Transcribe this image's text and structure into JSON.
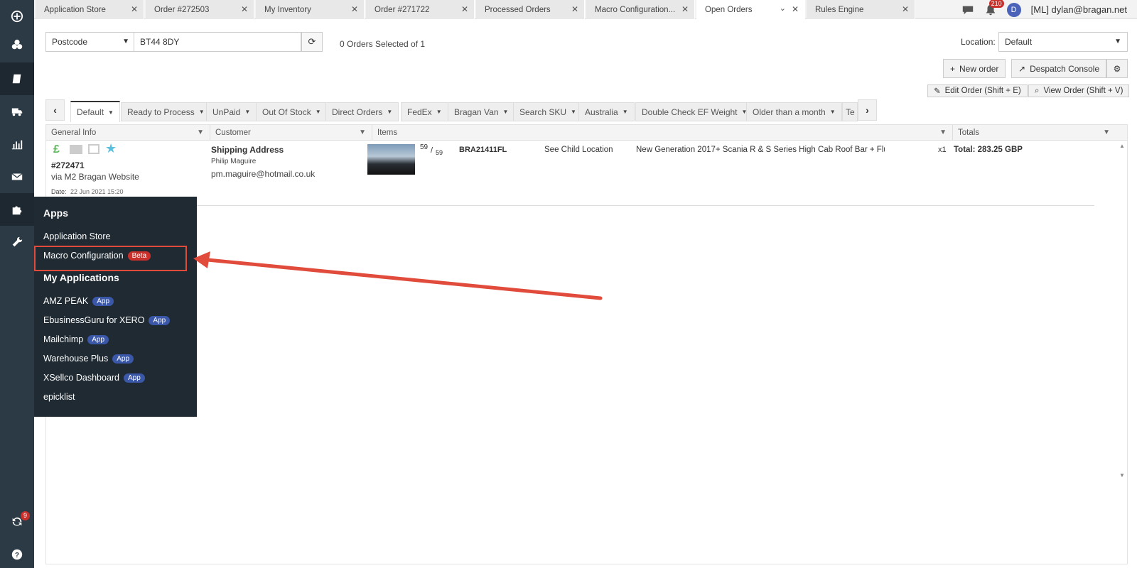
{
  "tabs": [
    {
      "label": "Application Store"
    },
    {
      "label": "Order #272503"
    },
    {
      "label": "My Inventory"
    },
    {
      "label": "Order #271722"
    },
    {
      "label": "Processed Orders"
    },
    {
      "label": "Macro Configuration..."
    },
    {
      "label": "Open Orders"
    },
    {
      "label": "Rules Engine"
    }
  ],
  "topbar": {
    "notification_count": "210",
    "avatar_letter": "D",
    "user": "[ML] dylan@bragan.net"
  },
  "rail": {
    "sync_badge": "9"
  },
  "search": {
    "field": "Postcode",
    "value": "BT44 8DY",
    "selection_text": "0 Orders Selected of 1"
  },
  "location": {
    "label": "Location:",
    "value": "Default"
  },
  "actions": {
    "new_order": "New order",
    "despatch_console": "Despatch Console",
    "edit_order": "Edit Order (Shift + E)",
    "view_order": "View Order (Shift + V)"
  },
  "view_tabs": [
    {
      "label": "Default"
    },
    {
      "label": "Ready to Process"
    },
    {
      "label": "UnPaid"
    },
    {
      "label": "Out Of Stock"
    },
    {
      "label": "Direct Orders"
    },
    {
      "label": "FedEx"
    },
    {
      "label": "Bragan Van"
    },
    {
      "label": "Search SKU"
    },
    {
      "label": "Australia"
    },
    {
      "label": "Double Check EF Weight"
    },
    {
      "label": "Older than a month"
    },
    {
      "label": "Te"
    }
  ],
  "grid": {
    "headers": {
      "general_info": "General Info",
      "customer": "Customer",
      "items": "Items",
      "totals": "Totals"
    },
    "order": {
      "number": "#272471",
      "source": "via M2 Bragan Website",
      "date_label": "Date:",
      "date": "22 Jun 2021 15:20",
      "currency_symbol": "£",
      "address_title": "Shipping Address",
      "customer_name": "Philip Maguire",
      "email": "pm.maguire@hotmail.co.uk",
      "qty_top": "59",
      "qty_sep": "/",
      "qty_bottom": "59",
      "sku": "BRA21411FL",
      "location": "See Child Location",
      "title": "New Generation 2017+ Scania R & S Series High Cab Roof Bar + Flu...",
      "qty": "x1",
      "total": "Total: 283.25 GBP"
    }
  },
  "apps_menu": {
    "apps_heading": "Apps",
    "application_store": "Application Store",
    "macro_configuration": "Macro Configuration",
    "beta": "Beta",
    "my_apps_heading": "My Applications",
    "my_apps": [
      {
        "label": "AMZ PEAK",
        "tag": "App"
      },
      {
        "label": "EbusinessGuru for XERO",
        "tag": "App"
      },
      {
        "label": "Mailchimp",
        "tag": "App"
      },
      {
        "label": "Warehouse Plus",
        "tag": "App"
      },
      {
        "label": "XSellco Dashboard",
        "tag": "App"
      },
      {
        "label": "epicklist",
        "tag": ""
      }
    ]
  },
  "colors": {
    "rail": "#2b3a44",
    "flyout": "#1f2a33",
    "beta": "#c9302c",
    "app_pill": "#3a57a8",
    "annotation": "#e14b3b"
  }
}
